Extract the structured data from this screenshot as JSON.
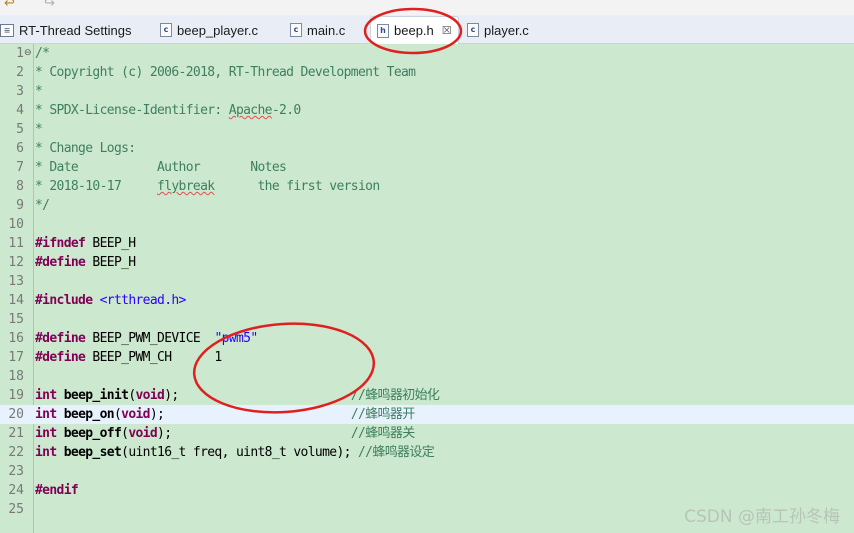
{
  "editor_tabs": [
    {
      "icon": "project-settings-icon",
      "label": "RT-Thread Settings",
      "active": false
    },
    {
      "icon": "c-file-icon",
      "label": "beep_player.c",
      "active": false
    },
    {
      "icon": "c-file-icon",
      "label": "main.c",
      "active": false
    },
    {
      "icon": "h-file-icon",
      "label": "beep.h",
      "active": true,
      "close": "☒"
    },
    {
      "icon": "c-file-icon",
      "label": "player.c",
      "active": false
    }
  ],
  "file_icon_letters": {
    "c": "c",
    "h": "h"
  },
  "current_line": 20,
  "code_lines": [
    {
      "n": "1",
      "fold": "⊖",
      "segments": [
        {
          "t": "/*",
          "c": "cm"
        }
      ]
    },
    {
      "n": "2",
      "segments": [
        {
          "t": "* Copyright (c) 2006-2018, RT-Thread Development Team",
          "c": "cm"
        }
      ]
    },
    {
      "n": "3",
      "segments": [
        {
          "t": "*",
          "c": "cm"
        }
      ]
    },
    {
      "n": "4",
      "segments": [
        {
          "t": "* SPDX-License-Identifier: ",
          "c": "cm"
        },
        {
          "t": "Apache",
          "c": "cm sq"
        },
        {
          "t": "-2.0",
          "c": "cm"
        }
      ]
    },
    {
      "n": "5",
      "segments": [
        {
          "t": "*",
          "c": "cm"
        }
      ]
    },
    {
      "n": "6",
      "segments": [
        {
          "t": "* Change Logs:",
          "c": "cm"
        }
      ]
    },
    {
      "n": "7",
      "segments": [
        {
          "t": "* Date           Author       Notes",
          "c": "cm"
        }
      ]
    },
    {
      "n": "8",
      "segments": [
        {
          "t": "* 2018-10-17     ",
          "c": "cm"
        },
        {
          "t": "flybreak",
          "c": "cm sq"
        },
        {
          "t": "      the first version",
          "c": "cm"
        }
      ]
    },
    {
      "n": "9",
      "segments": [
        {
          "t": "*/",
          "c": "cm"
        }
      ]
    },
    {
      "n": "10",
      "segments": []
    },
    {
      "n": "11",
      "segments": [
        {
          "t": "#ifndef",
          "c": "kw"
        },
        {
          "t": " BEEP_H",
          "c": ""
        }
      ]
    },
    {
      "n": "12",
      "segments": [
        {
          "t": "#define",
          "c": "kw"
        },
        {
          "t": " BEEP_H",
          "c": ""
        }
      ]
    },
    {
      "n": "13",
      "segments": []
    },
    {
      "n": "14",
      "segments": [
        {
          "t": "#include",
          "c": "kw"
        },
        {
          "t": " ",
          "c": ""
        },
        {
          "t": "<rtthread.h>",
          "c": "str"
        }
      ]
    },
    {
      "n": "15",
      "segments": []
    },
    {
      "n": "16",
      "segments": [
        {
          "t": "#define",
          "c": "kw"
        },
        {
          "t": " BEEP_PWM_DEVICE  ",
          "c": ""
        },
        {
          "t": "\"pwm5\"",
          "c": "str"
        }
      ]
    },
    {
      "n": "17",
      "segments": [
        {
          "t": "#define",
          "c": "kw"
        },
        {
          "t": " BEEP_PWM_CH      1",
          "c": ""
        }
      ]
    },
    {
      "n": "18",
      "segments": []
    },
    {
      "n": "19",
      "segments": [
        {
          "t": "int",
          "c": "kw"
        },
        {
          "t": " ",
          "c": ""
        },
        {
          "t": "beep_init",
          "c": "fn"
        },
        {
          "t": "(",
          "c": ""
        },
        {
          "t": "void",
          "c": "kw"
        },
        {
          "t": ");                        ",
          "c": ""
        },
        {
          "t": "//蜂鸣器初始化",
          "c": "cm"
        }
      ]
    },
    {
      "n": "20",
      "segments": [
        {
          "t": "int",
          "c": "kw"
        },
        {
          "t": " ",
          "c": ""
        },
        {
          "t": "beep_on",
          "c": "fn"
        },
        {
          "t": "(",
          "c": ""
        },
        {
          "t": "void",
          "c": "kw"
        },
        {
          "t": ");                          ",
          "c": ""
        },
        {
          "t": "//蜂鸣器开",
          "c": "cm"
        }
      ]
    },
    {
      "n": "21",
      "segments": [
        {
          "t": "int",
          "c": "kw"
        },
        {
          "t": " ",
          "c": ""
        },
        {
          "t": "beep_off",
          "c": "fn"
        },
        {
          "t": "(",
          "c": ""
        },
        {
          "t": "void",
          "c": "kw"
        },
        {
          "t": ");                         ",
          "c": ""
        },
        {
          "t": "//蜂鸣器关",
          "c": "cm"
        }
      ]
    },
    {
      "n": "22",
      "segments": [
        {
          "t": "int",
          "c": "kw"
        },
        {
          "t": " ",
          "c": ""
        },
        {
          "t": "beep_set",
          "c": "fn"
        },
        {
          "t": "(uint16_t freq, uint8_t volume); ",
          "c": ""
        },
        {
          "t": "//蜂鸣器设定",
          "c": "cm"
        }
      ]
    },
    {
      "n": "23",
      "segments": []
    },
    {
      "n": "24",
      "segments": [
        {
          "t": "#endif",
          "c": "kw"
        }
      ]
    },
    {
      "n": "25",
      "segments": []
    }
  ],
  "watermark": "CSDN @南工孙冬梅",
  "colors": {
    "editor_bg": "#cce8cf",
    "keyword": "#7f0055",
    "comment": "#3f7f5f",
    "string": "#2a00ff",
    "annotation": "#e02020"
  }
}
